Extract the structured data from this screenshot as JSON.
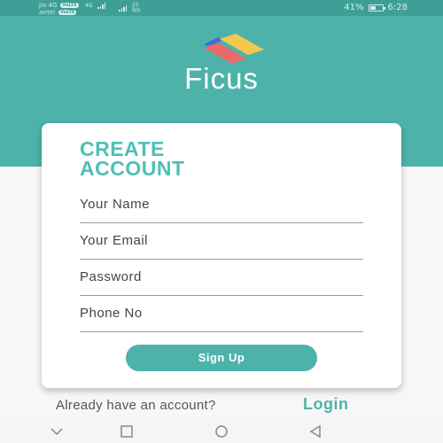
{
  "status_bar": {
    "carrier_top": "Jio 4G",
    "carrier_top_badge": "VoLTE",
    "carrier_bottom": "airtel",
    "carrier_bottom_badge": "VoLTE",
    "network_type": "4G",
    "speed_value": "25",
    "speed_unit": "B/s",
    "battery_percent": "41%",
    "time": "6:28"
  },
  "app": {
    "name": "Ficus",
    "logo_colors": [
      "#3f6fd8",
      "#f2c94c",
      "#e86a6a"
    ]
  },
  "form": {
    "title_line1": "CREATE",
    "title_line2": "ACCOUNT",
    "fields": [
      {
        "label": "Your Name"
      },
      {
        "label": "Your Email"
      },
      {
        "label": "Password"
      },
      {
        "label": "Phone No"
      }
    ],
    "submit_label": "Sign Up"
  },
  "footer": {
    "prompt": "Already have an account?",
    "login_label": "Login"
  },
  "nav": {
    "icons": [
      "chevron-down-icon",
      "square-icon",
      "circle-icon",
      "back-triangle-icon"
    ]
  },
  "colors": {
    "primary": "#4db3aa",
    "title": "#4dc0b5",
    "status_bar": "#3d9f95"
  }
}
